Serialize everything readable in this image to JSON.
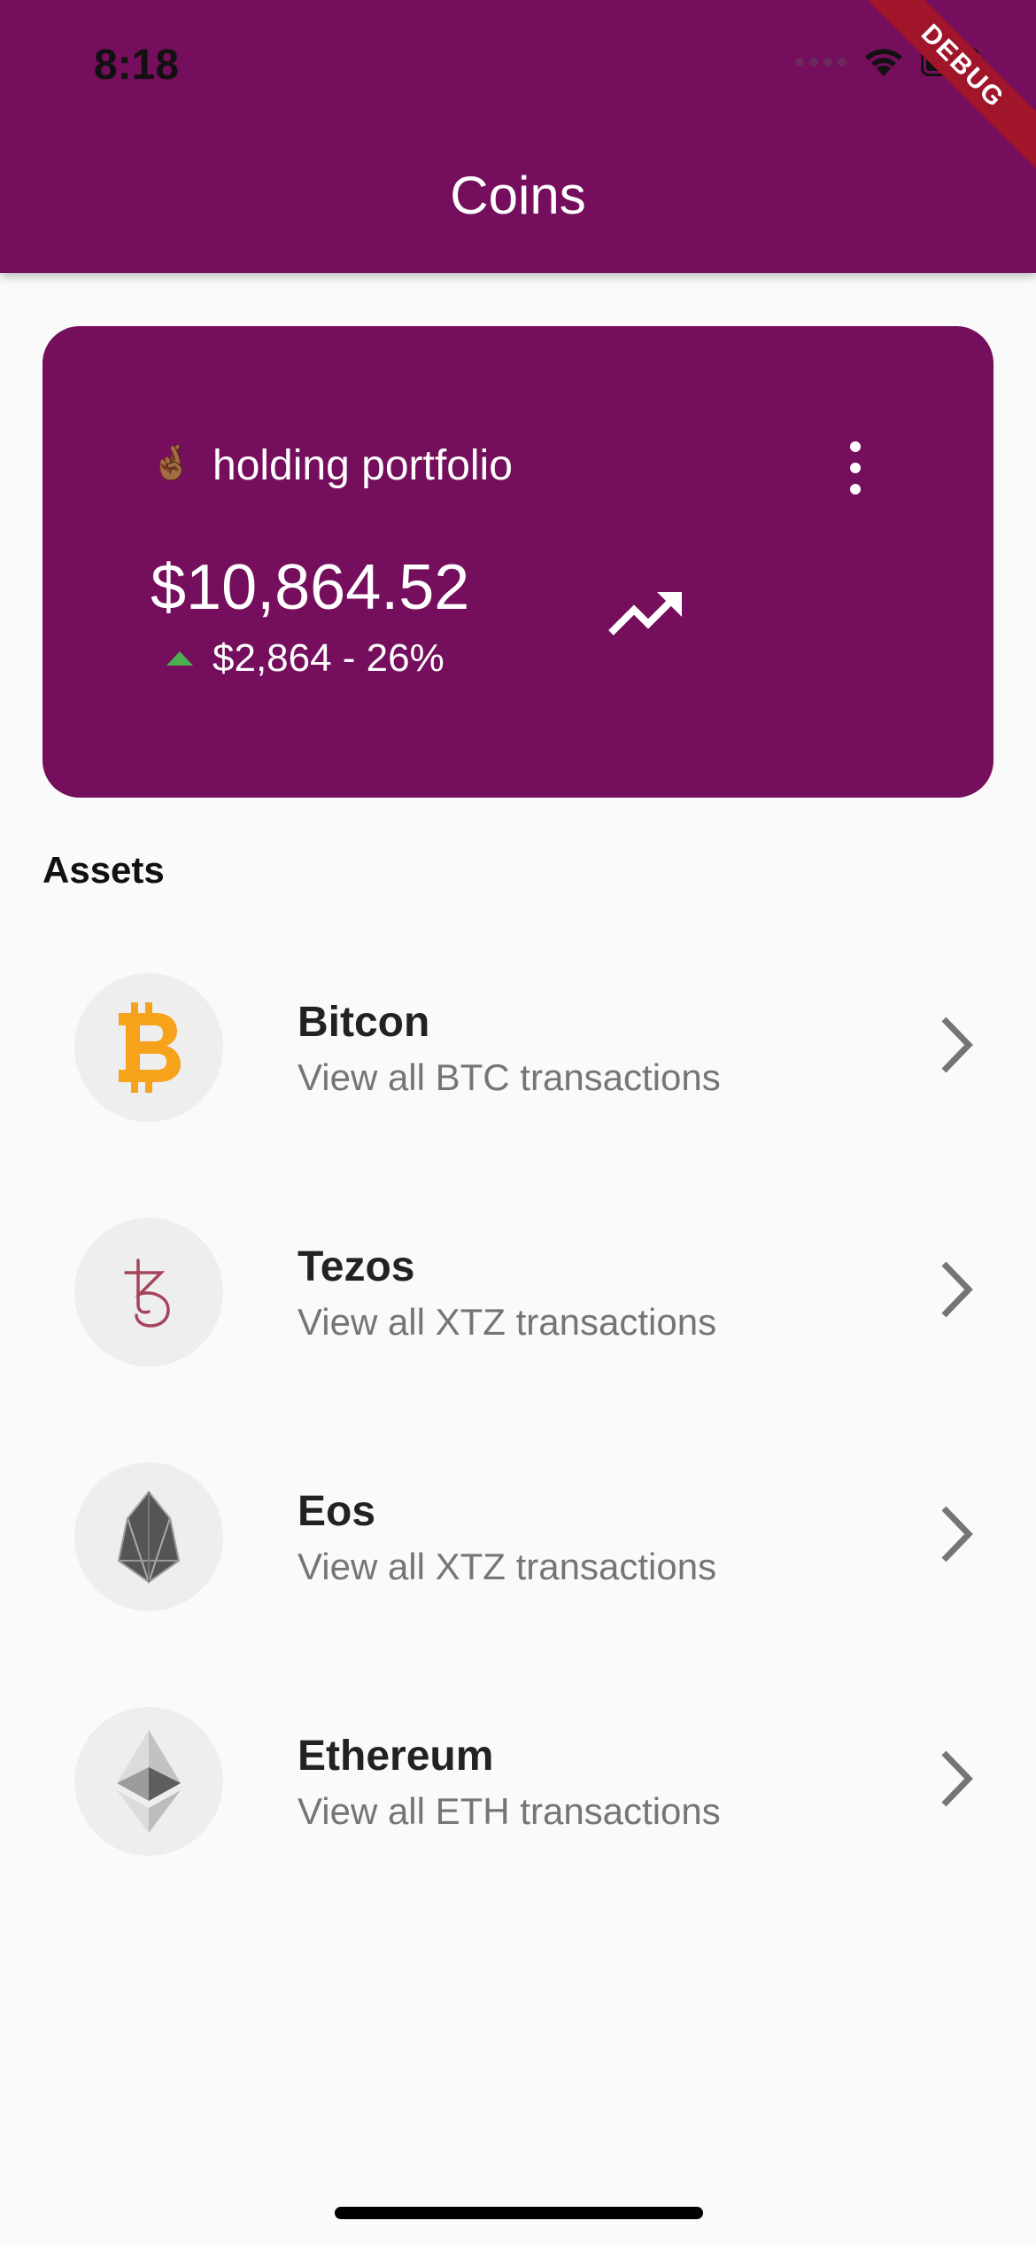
{
  "status_bar": {
    "time": "8:18",
    "debug_label": "DEBUG"
  },
  "app_bar": {
    "title": "Coins"
  },
  "portfolio": {
    "emoji": "🤞🏾",
    "title": "holding portfolio",
    "balance": "$10,864.52",
    "change": "$2,864 - 26%",
    "change_direction": "up",
    "colors": {
      "card": "#750e5c",
      "up": "#4caf50"
    }
  },
  "assets": {
    "heading": "Assets",
    "items": [
      {
        "name": "Bitcon",
        "subtitle": "View all BTC transactions",
        "icon": "bitcoin-icon",
        "color": "#f7a21b"
      },
      {
        "name": "Tezos",
        "subtitle": "View all XTZ transactions",
        "icon": "tezos-icon",
        "color": "#a6445c"
      },
      {
        "name": "Eos",
        "subtitle": "View all XTZ transactions",
        "icon": "eos-icon",
        "color": "#444444"
      },
      {
        "name": "Ethereum",
        "subtitle": "View all ETH transactions",
        "icon": "ethereum-icon",
        "color": "#8c8c8c"
      }
    ]
  }
}
